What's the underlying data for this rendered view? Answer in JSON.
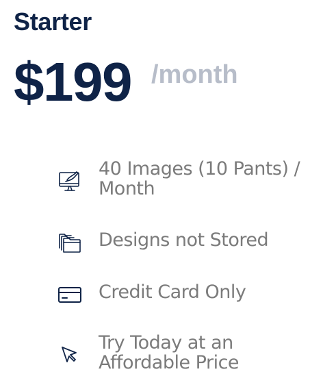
{
  "plan": {
    "name": "Starter",
    "price": "$199",
    "period": "/month"
  },
  "features": [
    {
      "icon": "monitor-brush-icon",
      "text": "40 Images (10 Pants) / Month"
    },
    {
      "icon": "folders-icon",
      "text": "Designs not Stored"
    },
    {
      "icon": "credit-card-icon",
      "text": "Credit Card Only"
    },
    {
      "icon": "cursor-arrow-icon",
      "text": "Try Today at an Affordable Price"
    }
  ],
  "colors": {
    "title": "#0f2347",
    "period": "#b7bdc9",
    "feature_text": "#7b7b7b",
    "icon": "#0f2347"
  }
}
